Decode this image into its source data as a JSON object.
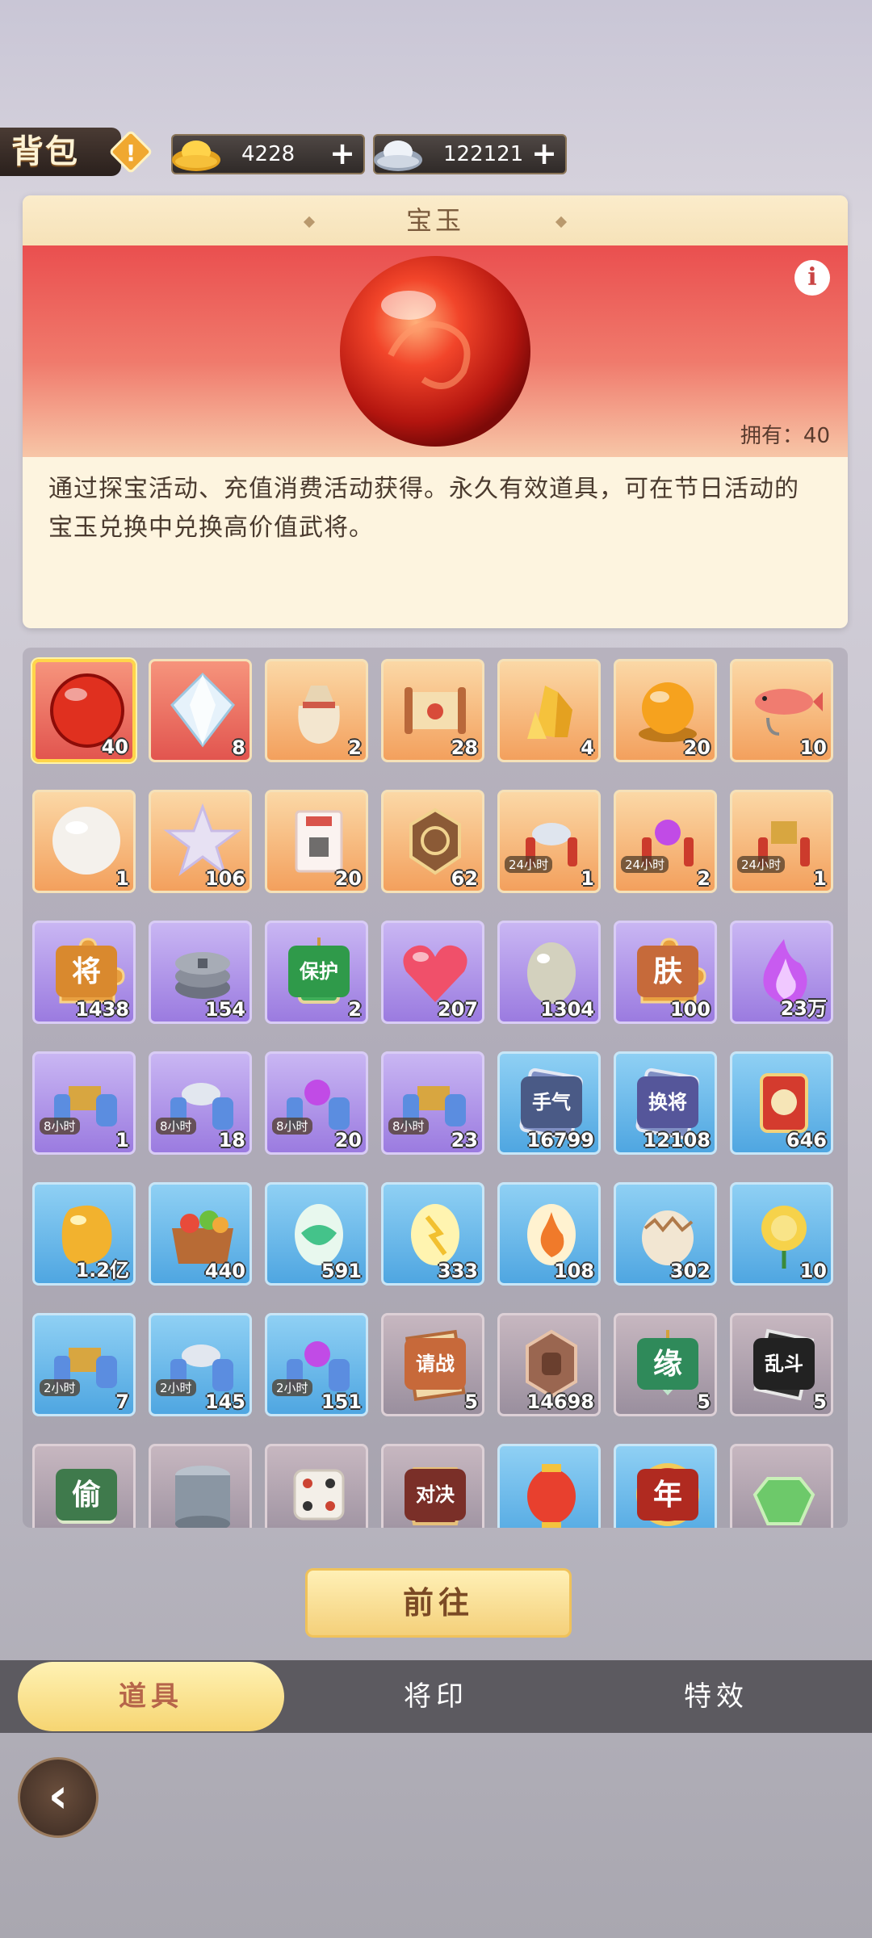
{
  "header": {
    "title": "背包",
    "gold": "4228",
    "silver": "122121"
  },
  "detail": {
    "name": "宝玉",
    "owned_label": "拥有：40",
    "description": "通过探宝活动、充值消费活动获得。永久有效道具，可在节日活动的宝玉兑换中兑换高价值武将。"
  },
  "items": [
    {
      "icon": "red-orb",
      "quality": "red",
      "count": "40",
      "selected": true
    },
    {
      "icon": "white-gem",
      "quality": "red",
      "count": "8"
    },
    {
      "icon": "pouch",
      "quality": "orange",
      "count": "2"
    },
    {
      "icon": "scroll",
      "quality": "orange",
      "count": "28"
    },
    {
      "icon": "gold-crystal",
      "quality": "orange",
      "count": "4"
    },
    {
      "icon": "golden-orb",
      "quality": "orange",
      "count": "20"
    },
    {
      "icon": "fish",
      "quality": "orange",
      "count": "10"
    },
    {
      "icon": "pearl",
      "quality": "orange",
      "count": "1"
    },
    {
      "icon": "star",
      "quality": "orange",
      "count": "106"
    },
    {
      "icon": "package",
      "quality": "orange",
      "count": "20"
    },
    {
      "icon": "badge",
      "quality": "orange",
      "count": "62"
    },
    {
      "icon": "silver-firecracker",
      "quality": "orange",
      "count": "1",
      "timer": "24小时"
    },
    {
      "icon": "purple-firecracker",
      "quality": "orange",
      "count": "2",
      "timer": "24小时"
    },
    {
      "icon": "gift-firecracker",
      "quality": "orange",
      "count": "1",
      "timer": "24小时"
    },
    {
      "icon": "puzzle",
      "quality": "purple",
      "count": "1438",
      "tag": "将"
    },
    {
      "icon": "coins",
      "quality": "purple",
      "count": "154"
    },
    {
      "icon": "amulet",
      "quality": "purple",
      "count": "2",
      "tag": "保护"
    },
    {
      "icon": "heart",
      "quality": "purple",
      "count": "207"
    },
    {
      "icon": "rainbow-egg",
      "quality": "purple",
      "count": "1304"
    },
    {
      "icon": "puzzle",
      "quality": "purple",
      "count": "100",
      "tag": "肤"
    },
    {
      "icon": "purple-flame",
      "quality": "purple",
      "count": "23万"
    },
    {
      "icon": "gift-scroll",
      "quality": "purple",
      "count": "1",
      "timer": "8小时"
    },
    {
      "icon": "silver-scroll",
      "quality": "purple",
      "count": "18",
      "timer": "8小时"
    },
    {
      "icon": "purple-scroll",
      "quality": "purple",
      "count": "20",
      "timer": "8小时"
    },
    {
      "icon": "gift-scroll",
      "quality": "purple",
      "count": "23",
      "timer": "8小时"
    },
    {
      "icon": "card",
      "quality": "blue",
      "count": "16799",
      "tag": "手气"
    },
    {
      "icon": "card",
      "quality": "blue",
      "count": "12108",
      "tag": "换将"
    },
    {
      "icon": "red-token",
      "quality": "blue",
      "count": "646"
    },
    {
      "icon": "bean",
      "quality": "blue",
      "count": "1.2亿"
    },
    {
      "icon": "basket",
      "quality": "blue",
      "count": "440"
    },
    {
      "icon": "green-egg",
      "quality": "blue",
      "count": "591"
    },
    {
      "icon": "yellow-egg",
      "quality": "blue",
      "count": "333"
    },
    {
      "icon": "fire-egg",
      "quality": "blue",
      "count": "108"
    },
    {
      "icon": "cracked-egg",
      "quality": "blue",
      "count": "302"
    },
    {
      "icon": "rose",
      "quality": "blue",
      "count": "10"
    },
    {
      "icon": "gift-scroll",
      "quality": "blue",
      "count": "7",
      "timer": "2小时"
    },
    {
      "icon": "silver-scroll",
      "quality": "blue",
      "count": "145",
      "timer": "2小时"
    },
    {
      "icon": "purple-scroll",
      "quality": "blue",
      "count": "151",
      "timer": "2小时"
    },
    {
      "icon": "paper",
      "quality": "gray",
      "count": "5",
      "tag": "请战"
    },
    {
      "icon": "fist-badge",
      "quality": "gray",
      "count": "14698"
    },
    {
      "icon": "jade",
      "quality": "gray",
      "count": "5",
      "tag": "缘"
    },
    {
      "icon": "scroll-black",
      "quality": "gray",
      "count": "5",
      "tag": "乱斗"
    },
    {
      "icon": "ticket",
      "quality": "gray",
      "count": "",
      "tag": "偷"
    },
    {
      "icon": "can",
      "quality": "gray",
      "count": ""
    },
    {
      "icon": "dice",
      "quality": "gray",
      "count": ""
    },
    {
      "icon": "token",
      "quality": "gray",
      "count": "",
      "tag": "对决"
    },
    {
      "icon": "lantern",
      "quality": "blue",
      "count": ""
    },
    {
      "icon": "year-badge",
      "quality": "blue",
      "count": "",
      "tag": "年"
    },
    {
      "icon": "green-gem",
      "quality": "gray",
      "count": ""
    }
  ],
  "go_button": "前往",
  "tabs": [
    {
      "label": "道具",
      "active": true
    },
    {
      "label": "将印",
      "active": false
    },
    {
      "label": "特效",
      "active": false
    }
  ],
  "colors": {
    "accent": "#f6d572",
    "red_quality": "#e2554f",
    "orange_quality": "#f3a05d",
    "purple_quality": "#9b7be0",
    "blue_quality": "#4fa6e1"
  }
}
